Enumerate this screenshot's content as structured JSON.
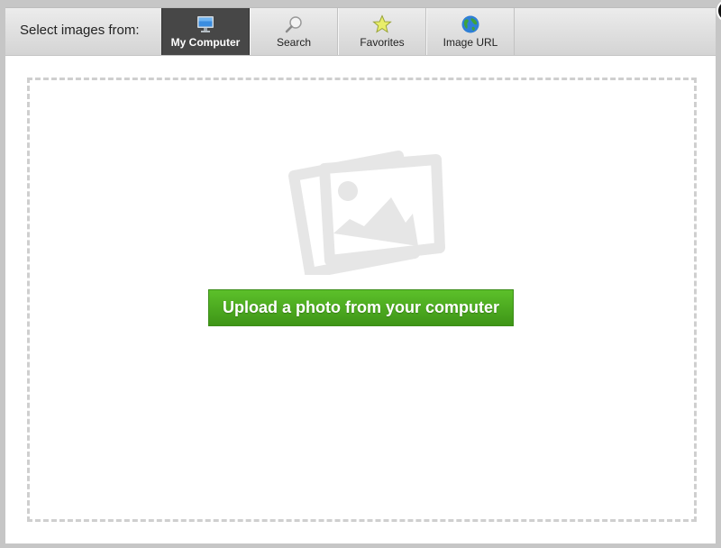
{
  "tabbar": {
    "label": "Select images from:",
    "tabs": [
      {
        "label": "My Computer",
        "icon": "monitor-icon",
        "active": true
      },
      {
        "label": "Search",
        "icon": "magnifier-icon",
        "active": false
      },
      {
        "label": "Favorites",
        "icon": "star-icon",
        "active": false
      },
      {
        "label": "Image URL",
        "icon": "globe-icon",
        "active": false
      }
    ]
  },
  "main": {
    "placeholder_icon": "image-placeholder-icon",
    "upload_button_label": "Upload a photo from your computer"
  },
  "close": {
    "icon": "close-icon",
    "glyph": "✕"
  },
  "colors": {
    "active_tab": "#474747",
    "upload_button": "#4aa81f",
    "dashed_border": "#cfcfcf"
  }
}
